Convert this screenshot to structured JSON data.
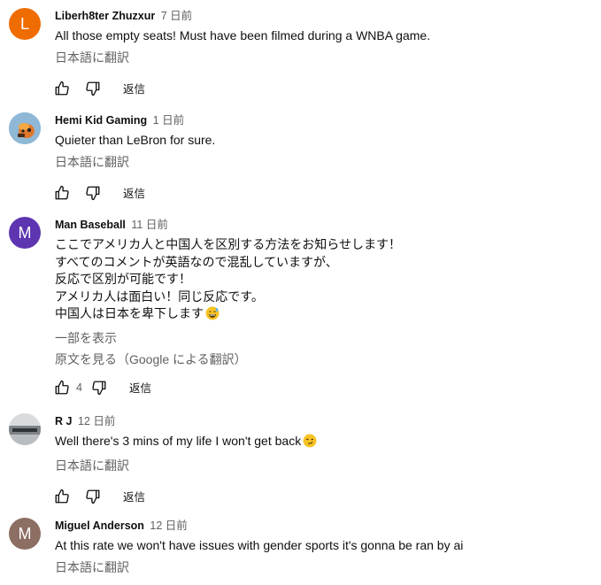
{
  "comments": [
    {
      "author": "Liberh8ter Zhuzxur",
      "time": "7 日前",
      "avatar_letter": "L",
      "avatar_color": "#ef6c00",
      "text": "All those empty seats! Must have been filmed during a WNBA game.",
      "translate_label": "日本語に翻訳",
      "likes": "",
      "reply_label": "返信"
    },
    {
      "author": "Hemi Kid Gaming",
      "time": "1 日前",
      "avatar_letter": "",
      "avatar_color": "#8fb7d6",
      "text": "Quieter than LeBron for sure.",
      "translate_label": "日本語に翻訳",
      "likes": "",
      "reply_label": "返信"
    },
    {
      "author": "Man Baseball",
      "time": "11 日前",
      "avatar_letter": "M",
      "avatar_color": "#5e35b1",
      "text": "ここでアメリカ人と中国人を区別する方法をお知らせします！\nすべてのコメントが英語なので混乱していますが、\n反応で区別が可能です！\nアメリカ人は面白い！同じ反応です。\n中国人は日本を卑下します",
      "show_more_label": "一部を表示",
      "original_label": "原文を見る（Google による翻訳）",
      "likes": "4",
      "reply_label": "返信"
    },
    {
      "author": "R J",
      "time": "12 日前",
      "avatar_letter": "",
      "avatar_color": "#cfd3d6",
      "text": "Well there's 3 mins of my life I won't get back",
      "translate_label": "日本語に翻訳",
      "likes": "",
      "reply_label": "返信"
    },
    {
      "author": "Miguel Anderson",
      "time": "12 日前",
      "avatar_letter": "M",
      "avatar_color": "#8d6e63",
      "text": "At this rate we won't have issues with gender sports it's gonna be ran by ai",
      "translate_label": "日本語に翻訳"
    }
  ]
}
